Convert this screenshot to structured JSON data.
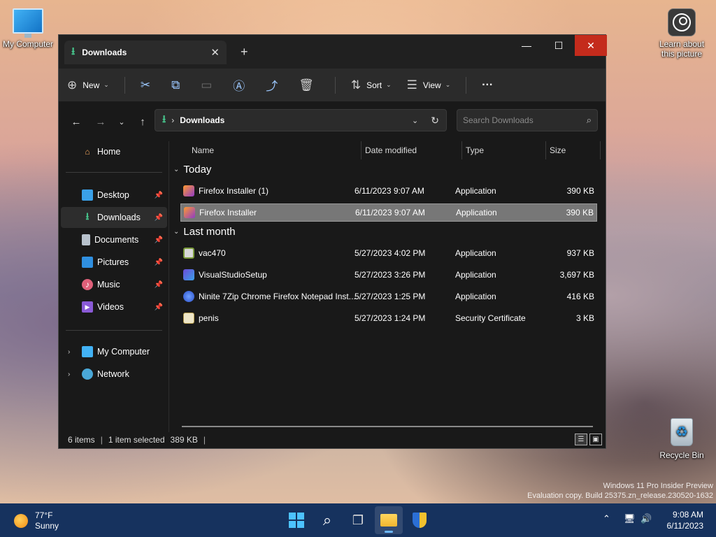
{
  "desktop": {
    "my_computer_label": "My Computer",
    "learn_label": "Learn about this picture",
    "recycle_bin_label": "Recycle Bin",
    "watermark_line1": "Windows 11 Pro Insider Preview",
    "watermark_line2": "Evaluation copy. Build 25375.zn_release.230520-1632"
  },
  "window": {
    "tab_title": "Downloads",
    "new_tab_symbol": "+",
    "controls": {
      "minimize": "—",
      "maximize": "☐",
      "close": "✕"
    },
    "colors": {
      "close_button": "#c42b1c",
      "accent": "#46c38b",
      "window_bg": "#191919"
    }
  },
  "toolbar": {
    "new_label": "New",
    "sort_label": "Sort",
    "view_label": "View",
    "more_label": "···",
    "icons": [
      "cut-icon",
      "copy-icon",
      "paste-icon",
      "rename-icon",
      "share-icon",
      "delete-icon"
    ]
  },
  "address": {
    "path": "Downloads",
    "search_placeholder": "Search Downloads"
  },
  "sidebar": {
    "home": "Home",
    "quick_access": [
      {
        "label": "Desktop",
        "icon": "desktop-icon",
        "color": "#3aa0e8"
      },
      {
        "label": "Downloads",
        "icon": "downloads-icon",
        "color": "#46c38b",
        "selected": true
      },
      {
        "label": "Documents",
        "icon": "documents-icon",
        "color": "#b8c2cc"
      },
      {
        "label": "Pictures",
        "icon": "pictures-icon",
        "color": "#2f8fe0"
      },
      {
        "label": "Music",
        "icon": "music-icon",
        "color": "#e0607a"
      },
      {
        "label": "Videos",
        "icon": "videos-icon",
        "color": "#8a5ad6"
      }
    ],
    "my_computer": "My Computer",
    "network": "Network"
  },
  "file_list": {
    "columns": [
      "Name",
      "Date modified",
      "Type",
      "Size"
    ],
    "groups": [
      {
        "label": "Today",
        "items": [
          {
            "name": "Firefox Installer (1)",
            "date": "6/11/2023 9:07 AM",
            "type": "Application",
            "size": "390 KB",
            "icon": "firefox-installer-icon"
          },
          {
            "name": "Firefox Installer",
            "date": "6/11/2023 9:07 AM",
            "type": "Application",
            "size": "390 KB",
            "icon": "firefox-installer-icon",
            "selected": true
          }
        ]
      },
      {
        "label": "Last month",
        "items": [
          {
            "name": "vac470",
            "date": "5/27/2023 4:02 PM",
            "type": "Application",
            "size": "937 KB",
            "icon": "app-setup-icon"
          },
          {
            "name": "VisualStudioSetup",
            "date": "5/27/2023 3:26 PM",
            "type": "Application",
            "size": "3,697 KB",
            "icon": "visual-studio-icon"
          },
          {
            "name": "Ninite 7Zip Chrome Firefox Notepad Inst...",
            "date": "5/27/2023 1:25 PM",
            "type": "Application",
            "size": "416 KB",
            "icon": "ninite-icon"
          },
          {
            "name": "penis",
            "date": "5/27/2023 1:24 PM",
            "type": "Security Certificate",
            "size": "3 KB",
            "icon": "certificate-icon"
          }
        ]
      }
    ]
  },
  "status": {
    "items_count": "6 items",
    "selection": "1 item selected",
    "selection_size": "389 KB"
  },
  "taskbar": {
    "temperature": "77°F",
    "condition": "Sunny",
    "time": "9:08 AM",
    "date": "6/11/2023",
    "apps": [
      "start-button",
      "search-button",
      "task-view-button",
      "file-explorer-button",
      "security-shield-button"
    ]
  }
}
